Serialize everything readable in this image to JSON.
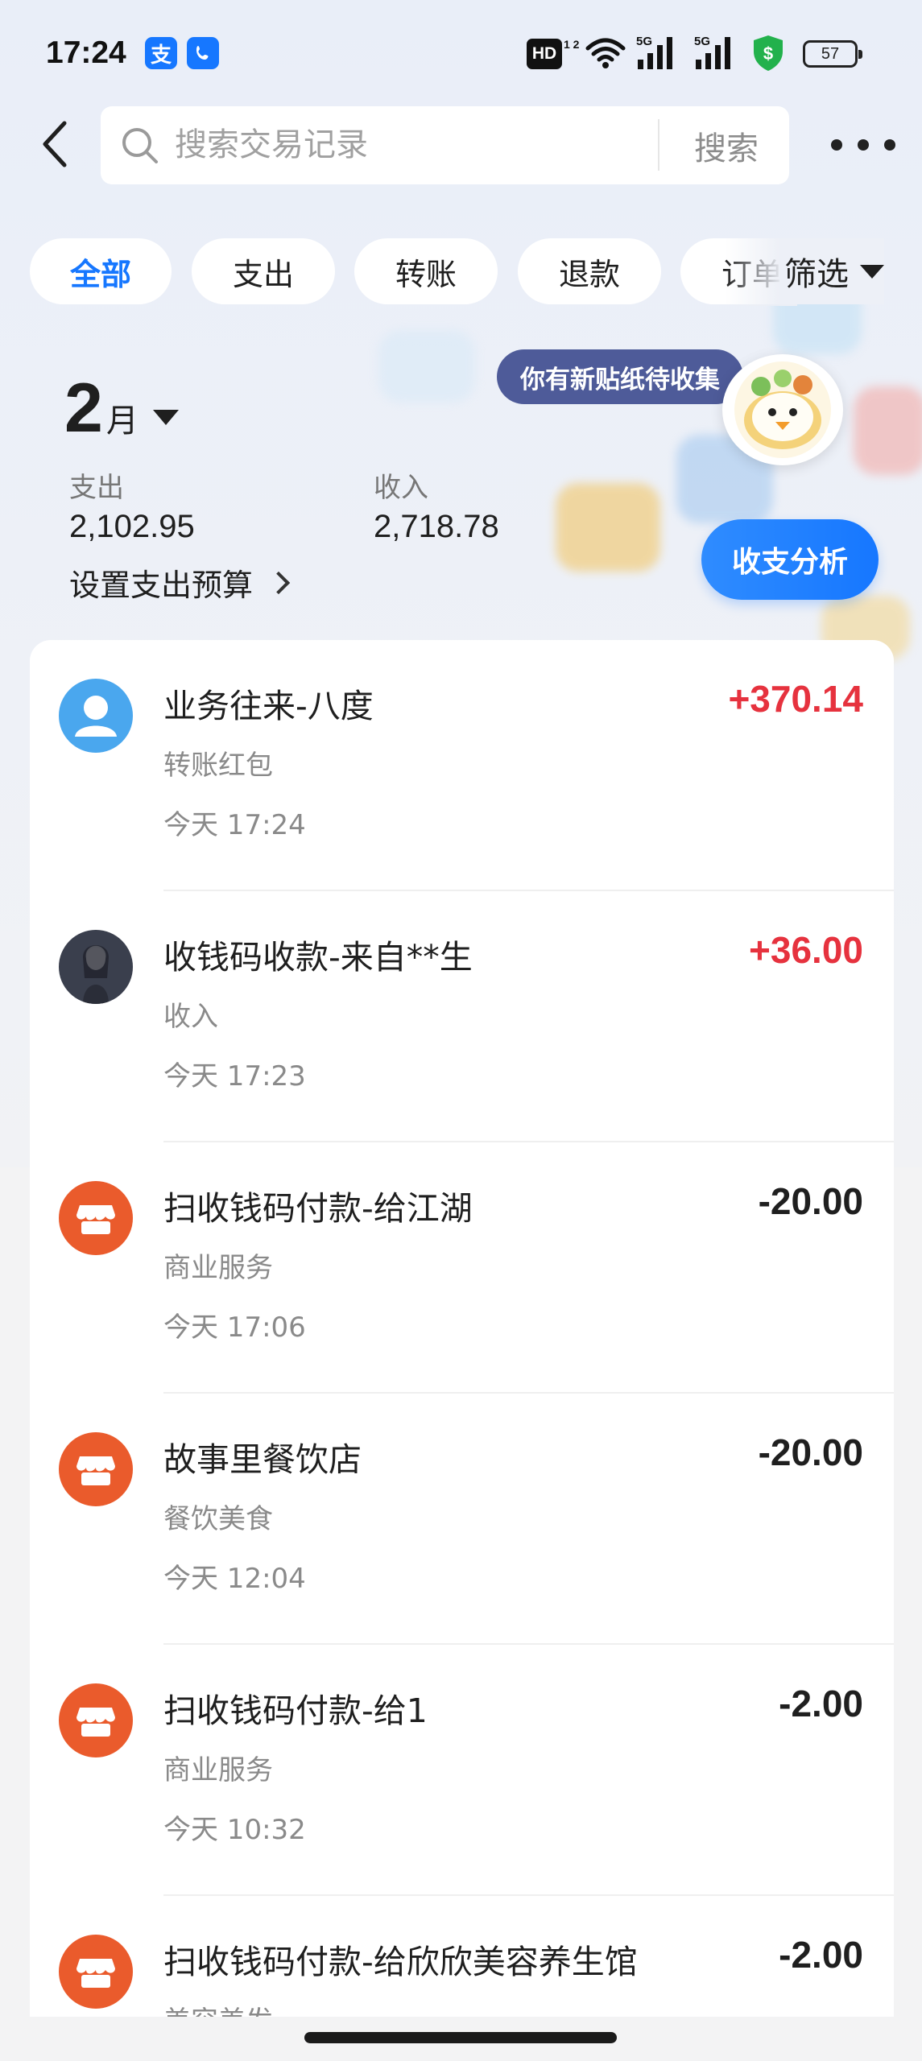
{
  "status_bar": {
    "time": "17:24",
    "app_icons": [
      "alipay-icon",
      "phone-icon"
    ],
    "hd_label": "HD",
    "hd_sub": "1 2",
    "network": "5G",
    "battery": "57",
    "colors": {
      "alipay": "#1677ff",
      "shield": "#22b14c"
    }
  },
  "header": {
    "search_placeholder": "搜索交易记录",
    "search_button": "搜索"
  },
  "tabs": [
    {
      "label": "全部",
      "active": true
    },
    {
      "label": "支出",
      "active": false
    },
    {
      "label": "转账",
      "active": false
    },
    {
      "label": "退款",
      "active": false
    },
    {
      "label": "订单",
      "active": false
    }
  ],
  "filter_label": "筛选",
  "summary": {
    "month_number": "2",
    "month_unit": "月",
    "expense_label": "支出",
    "expense_value": "2,102.95",
    "income_label": "收入",
    "income_value": "2,718.78",
    "budget_link": "设置支出预算",
    "sticker_notice": "你有新贴纸待收集",
    "analysis_button": "收支分析"
  },
  "transactions": [
    {
      "avatar": "person-icon",
      "title": "业务往来-八度",
      "category": "转账红包",
      "datetime": "今天 17:24",
      "amount": "+370.14",
      "type": "income"
    },
    {
      "avatar": "user-photo",
      "title": "收钱码收款-来自**生",
      "category": "收入",
      "datetime": "今天 17:23",
      "amount": "+36.00",
      "type": "income"
    },
    {
      "avatar": "shop-icon",
      "title": "扫收钱码付款-给江湖",
      "category": "商业服务",
      "datetime": "今天 17:06",
      "amount": "-20.00",
      "type": "expense"
    },
    {
      "avatar": "shop-icon",
      "title": "故事里餐饮店",
      "category": "餐饮美食",
      "datetime": "今天 12:04",
      "amount": "-20.00",
      "type": "expense"
    },
    {
      "avatar": "shop-icon",
      "title": "扫收钱码付款-给1",
      "category": "商业服务",
      "datetime": "今天 10:32",
      "amount": "-2.00",
      "type": "expense"
    },
    {
      "avatar": "shop-icon",
      "title": "扫收钱码付款-给欣欣美容养生馆",
      "category": "美容美发",
      "datetime": "",
      "amount": "-2.00",
      "type": "expense"
    }
  ],
  "colors": {
    "accent": "#1677ff",
    "income": "#e6323e",
    "shop_avatar": "#ea5b2c",
    "person_avatar": "#4aa7ee"
  }
}
